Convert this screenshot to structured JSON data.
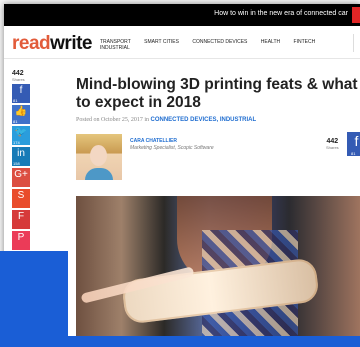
{
  "header": {
    "promo_text": "How to win in the new era of connected car"
  },
  "nav": {
    "logo_prefix": "read",
    "logo_suffix": "write",
    "items": [
      "TRANSPORT",
      "SMART CITIES",
      "CONNECTED DEVICES",
      "HEALTH",
      "FINTECH",
      "INDUSTRIAL"
    ]
  },
  "share_rail": {
    "count": "442",
    "label": "Shares",
    "facebook_count": "81",
    "like_count": "81",
    "twitter_count": "174",
    "linkedin_count": "158"
  },
  "article": {
    "title": "Mind-blowing 3D printing feats & what to expect in 2018",
    "posted_prefix": "Posted on October 25, 2017 in ",
    "category": "CONNECTED DEVICES, INDUSTRIAL",
    "author_name": "CARA CHATELLIER",
    "author_role": "Marketing Specialist, Scopic Software",
    "shares": "442",
    "shares_label": "Shares",
    "facebook_count": "81"
  }
}
